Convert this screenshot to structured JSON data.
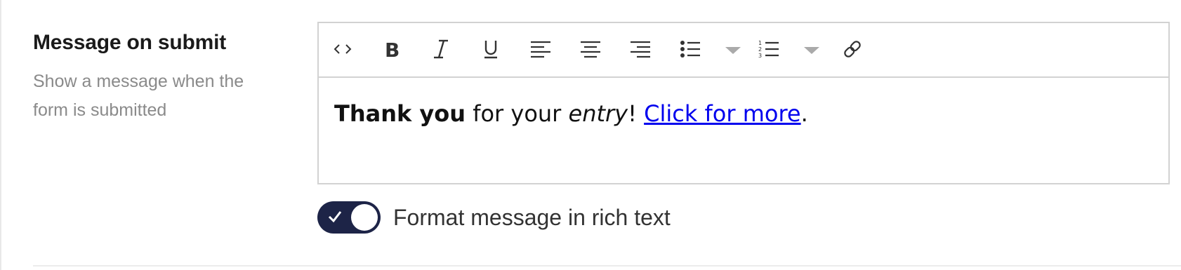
{
  "setting": {
    "title": "Message on submit",
    "description": "Show a message when the form is submitted"
  },
  "toolbar": {
    "buttons": [
      {
        "icon": "code-icon"
      },
      {
        "icon": "bold-icon"
      },
      {
        "icon": "italic-icon"
      },
      {
        "icon": "underline-icon"
      },
      {
        "icon": "align-left-icon"
      },
      {
        "icon": "align-center-icon"
      },
      {
        "icon": "align-right-icon"
      },
      {
        "icon": "bulleted-list-icon"
      },
      {
        "icon": "numbered-list-icon"
      },
      {
        "icon": "link-icon"
      }
    ]
  },
  "editor": {
    "bold_text": "Thank you",
    "text_1": " for your ",
    "italic_text": "entry",
    "text_2": "! ",
    "link_text": "Click for more",
    "text_3": "."
  },
  "rich_text_toggle": {
    "label": "Format message in rich text",
    "checked": true
  },
  "colors": {
    "toggle_on": "#1d2447",
    "link": "#0000ee",
    "border": "#d2d2d2",
    "muted_text": "#8a8a8a"
  }
}
